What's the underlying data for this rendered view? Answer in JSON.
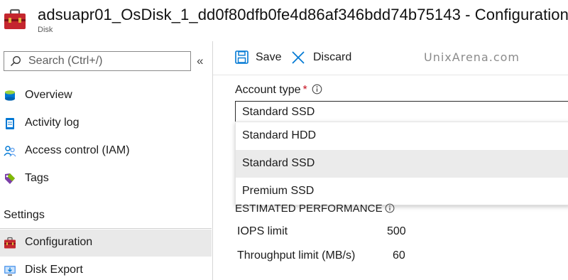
{
  "header": {
    "title": "adsuapr01_OsDisk_1_dd0f80dfb0fe4d86af346bdd74b75143 - Configuration",
    "subtitle": "Disk",
    "icon": "toolbox-icon"
  },
  "sidebar": {
    "search_placeholder": "Search (Ctrl+/)",
    "collapse_label": "«",
    "items": [
      {
        "label": "Overview",
        "icon": "disk-overview-icon"
      },
      {
        "label": "Activity log",
        "icon": "activity-log-icon"
      },
      {
        "label": "Access control (IAM)",
        "icon": "people-icon"
      },
      {
        "label": "Tags",
        "icon": "tag-icon"
      }
    ],
    "section_label": "Settings",
    "settings_items": [
      {
        "label": "Configuration",
        "icon": "toolbox-icon",
        "active": true
      },
      {
        "label": "Disk Export",
        "icon": "monitor-export-icon"
      }
    ]
  },
  "toolbar": {
    "save_label": "Save",
    "discard_label": "Discard",
    "watermark": "UnixArena.com"
  },
  "form": {
    "account_type_label": "Account type",
    "required_marker": "*",
    "selected_value": "Standard SSD",
    "options": [
      {
        "label": "Standard HDD",
        "selected": false
      },
      {
        "label": "Standard SSD",
        "selected": true
      },
      {
        "label": "Premium SSD",
        "selected": false
      }
    ]
  },
  "performance": {
    "title": "ESTIMATED PERFORMANCE",
    "rows": [
      {
        "label": "IOPS limit",
        "value": "500"
      },
      {
        "label": "Throughput limit (MB/s)",
        "value": "60"
      }
    ]
  },
  "colors": {
    "accent_blue": "#0078d4",
    "required_red": "#c50f1f",
    "toolbox_red": "#c4262e",
    "selected_bg": "#ebebeb"
  }
}
